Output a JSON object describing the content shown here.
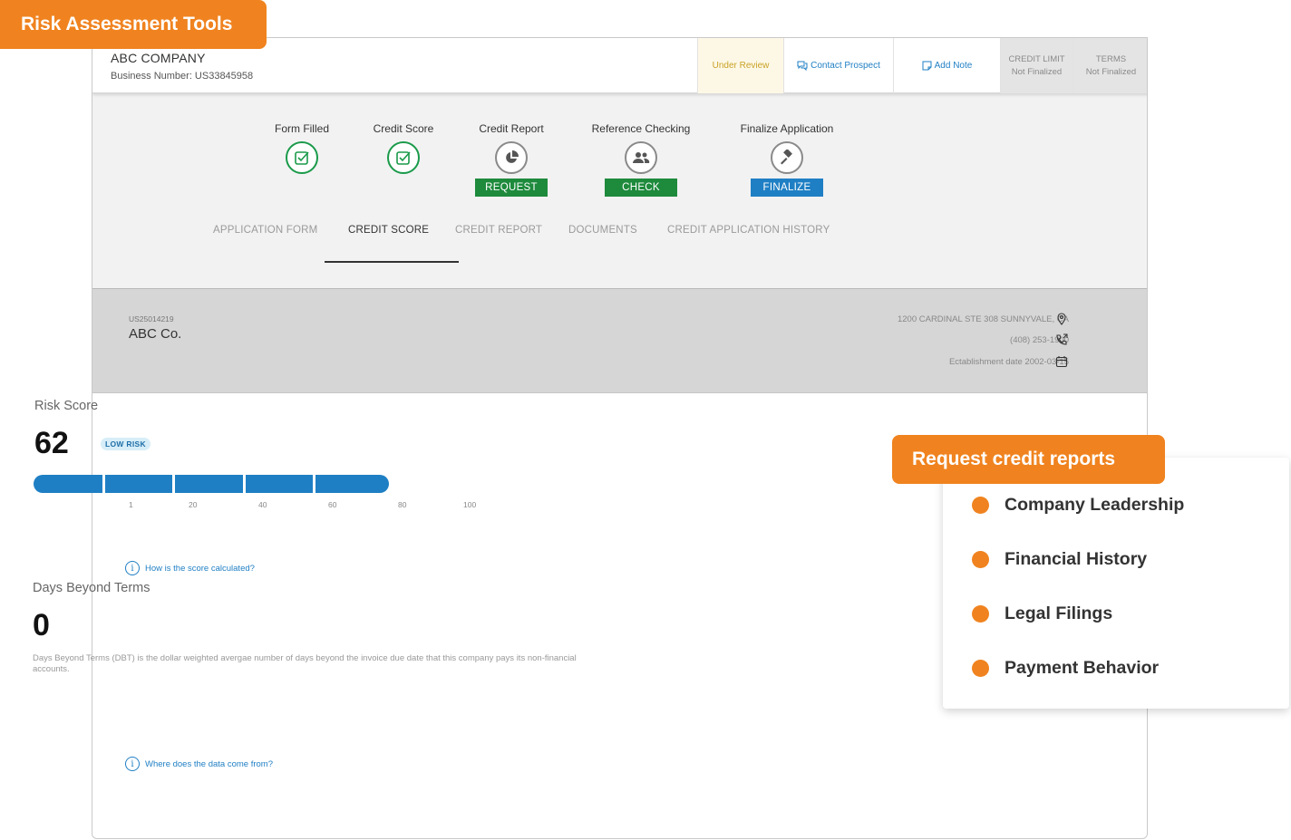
{
  "callouts": {
    "tools": "Risk Assessment Tools",
    "request": "Request credit reports"
  },
  "header": {
    "company_name": "ABC COMPANY",
    "business_number": "Business Number: US33845958",
    "status": "Under Review",
    "contact": "Contact Prospect",
    "add_note": "Add Note",
    "credit_limit_label": "CREDIT LIMIT",
    "credit_limit_value": "Not Finalized",
    "terms_label": "TERMS",
    "terms_value": "Not Finalized"
  },
  "steps": [
    {
      "label": "Form Filled",
      "state": "done",
      "icon": "checkbox-icon"
    },
    {
      "label": "Credit Score",
      "state": "done",
      "icon": "checkbox-icon"
    },
    {
      "label": "Credit Report",
      "state": "pending",
      "icon": "pie-chart-icon",
      "button": "REQUEST"
    },
    {
      "label": "Reference Checking",
      "state": "pending",
      "icon": "people-icon",
      "button": "CHECK"
    },
    {
      "label": "Finalize Application",
      "state": "pending",
      "icon": "gavel-icon",
      "button": "FINALIZE"
    }
  ],
  "tabs": [
    "APPLICATION FORM",
    "CREDIT SCORE",
    "CREDIT REPORT",
    "DOCUMENTS",
    "CREDIT APPLICATION HISTORY"
  ],
  "active_tab": "CREDIT SCORE",
  "company_info": {
    "id": "US25014219",
    "name": "ABC Co.",
    "address": "1200 CARDINAL STE 308 SUNNYVALE, CA",
    "phone": "(408) 253-1900",
    "established": "Ectablishment date 2002-03-15"
  },
  "risk": {
    "title": "Risk Score",
    "score": "62",
    "badge": "LOW RISK",
    "scale_ticks": [
      "1",
      "20",
      "40",
      "60",
      "80",
      "100"
    ],
    "help": "How is the score calculated?"
  },
  "dbt": {
    "title": "Days Beyond Terms",
    "value": "0",
    "description": "Days Beyond Terms (DBT) is the dollar weighted avergae number of days beyond the invoice due date that this company pays its non-financial accounts.",
    "help": "Where does the data come from?"
  },
  "report_options": [
    "Company Leadership",
    "Financial History",
    "Legal Filings",
    "Payment Behavior"
  ],
  "colors": {
    "accent_orange": "#f0831f",
    "primary_blue": "#1f7fc4",
    "success_green": "#1e8a3c"
  }
}
